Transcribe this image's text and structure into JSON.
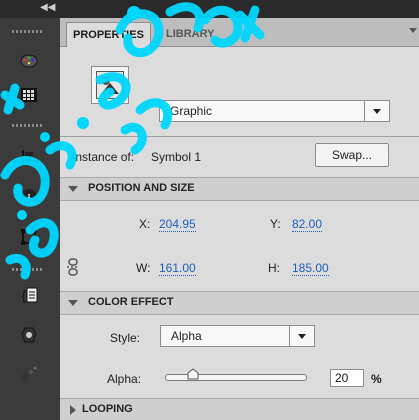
{
  "dock": {
    "collapse_icon": "double-chevron-left-icon",
    "icons": [
      "paint-palette-icon",
      "swatches-grid-icon",
      "align-icon",
      "info-icon",
      "transform-icon",
      "code-snippets-icon",
      "components-icon",
      "motion-presets-icon"
    ]
  },
  "tabs": [
    {
      "label": "PROPERTIES",
      "active": true
    },
    {
      "label": "LIBRARY",
      "active": false
    }
  ],
  "symbol": {
    "icon": "graphic-symbol-icon",
    "type_select": "Graphic",
    "instance_label": "Instance of:",
    "instance_name": "Symbol 1",
    "swap_label": "Swap..."
  },
  "position_size": {
    "title": "POSITION AND SIZE",
    "x_label": "X:",
    "x": "204.95",
    "y_label": "Y:",
    "y": "82.00",
    "w_label": "W:",
    "w": "161.00",
    "h_label": "H:",
    "h": "185.00",
    "lock_icon": "link-constrain-icon"
  },
  "color_effect": {
    "title": "COLOR EFFECT",
    "style_label": "Style:",
    "style": "Alpha",
    "alpha_label": "Alpha:",
    "alpha_value": "20",
    "alpha_unit": "%",
    "alpha_fraction": 0.2
  },
  "looping": {
    "title": "LOOPING"
  },
  "colors": {
    "value_blue": "#1f5fbf",
    "watermark_cyan": "#00d7ff"
  }
}
